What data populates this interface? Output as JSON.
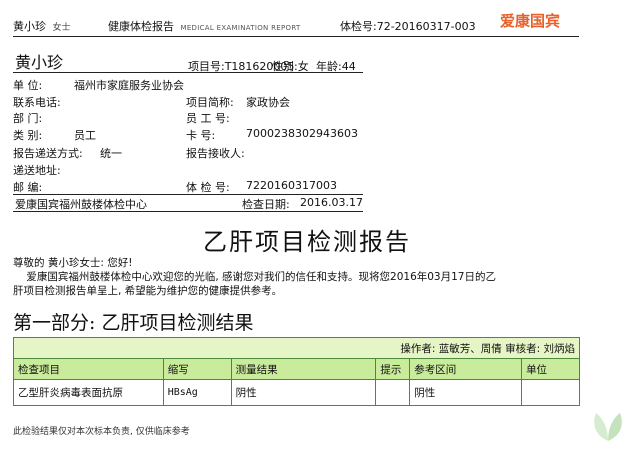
{
  "header": {
    "name": "黄小珍",
    "salutation": "女士",
    "report_cn": "健康体检报告",
    "report_en": "MEDICAL EXAMINATION REPORT",
    "exam_no": "体检号:72-20160317-003",
    "brand": "爱康国宾"
  },
  "info": {
    "name": "黄小珍",
    "project_no": "项目号:T181620005",
    "gender": "性别:女",
    "age": "年龄:44",
    "unit_label": "单    位:",
    "unit_value": "福州市家庭服务业协会",
    "phone_label": "联系电话:",
    "project_abbr_label": "项目简称:",
    "project_abbr_value": "家政协会",
    "dept_label": "部    门:",
    "employee_no_label": "员 工 号:",
    "category_label": "类    别:",
    "category_value": "员工",
    "card_label": "卡    号:",
    "card_value": "7000238302943603",
    "delivery_label": "报告递送方式:",
    "delivery_value": "统一",
    "recipient_label": "报告接收人:",
    "address_label": "递送地址:",
    "postcode_label": "邮    编:",
    "exam_no_label": "体 检 号:",
    "exam_no_value": "7220160317003",
    "center": "爱康国宾福州鼓楼体检中心",
    "date_label": "检查日期:",
    "date_value": "2016.03.17"
  },
  "report": {
    "title": "乙肝项目检测报告",
    "greeting": "尊敬的 黄小珍女士: 您好!",
    "para_line1": "    爱康国宾福州鼓楼体检中心欢迎您的光临, 感谢您对我们的信任和支持。现将您2016年03月17日的乙",
    "para_line2": "肝项目检测报告单呈上, 希望能为维护您的健康提供参考。",
    "section_title": "第一部分:  乙肝项目检测结果"
  },
  "table": {
    "operators": "操作者: 蓝敏芳、周倩    审核者: 刘炳焰",
    "headers": [
      "检查项目",
      "缩写",
      "测量结果",
      "提示",
      "参考区间",
      "单位"
    ],
    "rows": [
      [
        "乙型肝炎病毒表面抗原",
        "HBsAg",
        "阴性",
        "",
        "阴性",
        ""
      ]
    ]
  },
  "footer": {
    "note": "此检验结果仅对本次标本负责, 仅供临床参考"
  },
  "colors": {
    "brand": "#e8612b",
    "table_border": "#4a8a3a",
    "ops_bg": "#e6f5c6",
    "header_bg": "#c9eb9c"
  }
}
